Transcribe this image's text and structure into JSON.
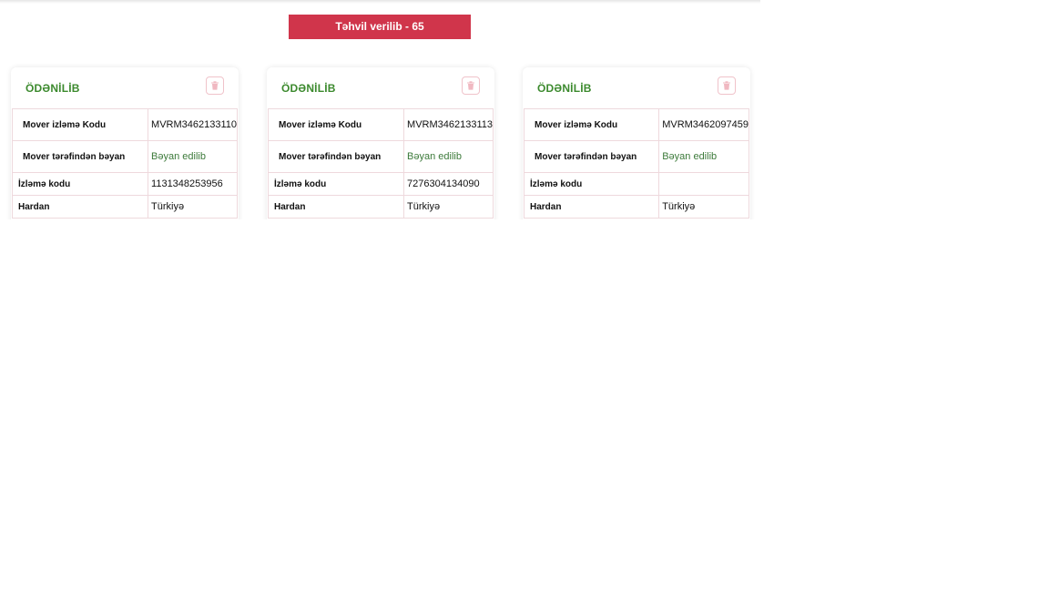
{
  "tab": {
    "label": "Təhvil verilib - 65"
  },
  "colors": {
    "accent": "#d0354b",
    "status_green": "#3c8a2e"
  },
  "cards": [
    {
      "status": "ÖDƏNİLİB",
      "delete_icon": "trash-icon",
      "rows": [
        {
          "label": "Mover izləmə Kodu",
          "value": "MVRM3462133110"
        },
        {
          "label": "Mover tərəfindən bəyan",
          "value": "Bəyan edilib"
        },
        {
          "label": "İzləmə kodu",
          "value": "1131348253956"
        },
        {
          "label": "Hardan",
          "value": "Türkiyə"
        }
      ]
    },
    {
      "status": "ÖDƏNİLİB",
      "delete_icon": "trash-icon",
      "rows": [
        {
          "label": "Mover izləmə Kodu",
          "value": "MVRM3462133113"
        },
        {
          "label": "Mover tərəfindən bəyan",
          "value": "Bəyan edilib"
        },
        {
          "label": "İzləmə kodu",
          "value": "7276304134090"
        },
        {
          "label": "Hardan",
          "value": "Türkiyə"
        }
      ]
    },
    {
      "status": "ÖDƏNİLİB",
      "delete_icon": "trash-icon",
      "rows": [
        {
          "label": "Mover izləmə Kodu",
          "value": "MVRM3462097459"
        },
        {
          "label": "Mover tərəfindən bəyan",
          "value": "Bəyan edilib"
        },
        {
          "label": "İzləmə kodu",
          "value": ""
        },
        {
          "label": "Hardan",
          "value": "Türkiyə"
        }
      ]
    }
  ]
}
